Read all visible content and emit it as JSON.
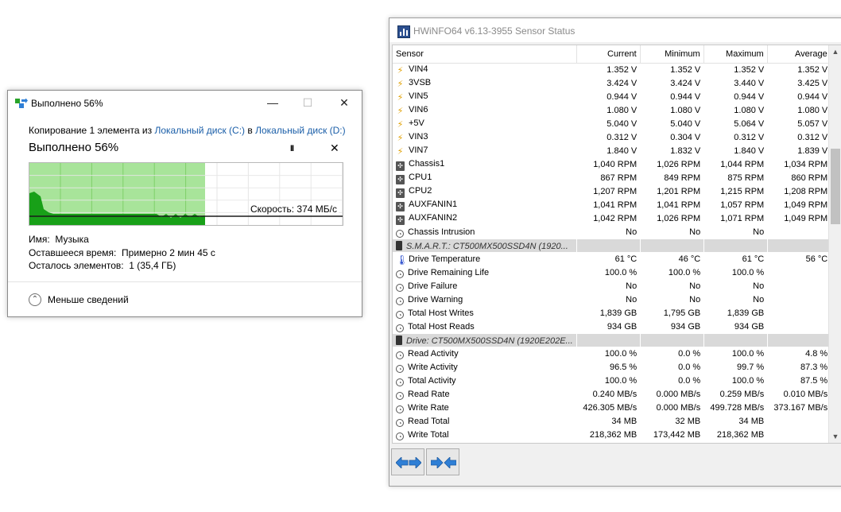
{
  "copy_dialog": {
    "title": "Выполнено 56%",
    "progress_percent": 56,
    "minimize_glyph": "—",
    "maximize_glyph": "☐",
    "close_glyph": "✕",
    "line_prefix": "Копирование 1 элемента из ",
    "source": "Локальный диск (C:)",
    "line_mid": " в ",
    "destination": "Локальный диск (D:)",
    "status": "Выполнено 56%",
    "pause_glyph": "II",
    "cancel_glyph": "✕",
    "speed": "Скорость: 374 МБ/с",
    "name_label": "Имя:",
    "name_value": "Музыка",
    "time_label": "Оставшееся время:",
    "time_value": "Примерно 2 мин 45 с",
    "items_label": "Осталось элементов:",
    "items_value": "1 (35,4 ГБ)",
    "less_details": "Меньше сведений",
    "colors": {
      "fill": "#a8e49a",
      "fill_border": "#7fcf6a",
      "speed_line": "#1b1b1b",
      "graph_fill": "#18a018",
      "link": "#1a5ea8"
    },
    "icon": "copy-files-icon"
  },
  "hwinfo": {
    "title": "HWiNFO64 v6.13-3955 Sensor Status",
    "columns": [
      "Sensor",
      "Current",
      "Minimum",
      "Maximum",
      "Average"
    ],
    "rows": [
      {
        "icon": "voltage-icon",
        "name": "VIN4",
        "current": "1.352 V",
        "minimum": "1.352 V",
        "maximum": "1.352 V",
        "average": "1.352 V"
      },
      {
        "icon": "voltage-icon",
        "name": "3VSB",
        "current": "3.424 V",
        "minimum": "3.424 V",
        "maximum": "3.440 V",
        "average": "3.425 V"
      },
      {
        "icon": "voltage-icon",
        "name": "VIN5",
        "current": "0.944 V",
        "minimum": "0.944 V",
        "maximum": "0.944 V",
        "average": "0.944 V"
      },
      {
        "icon": "voltage-icon",
        "name": "VIN6",
        "current": "1.080 V",
        "minimum": "1.080 V",
        "maximum": "1.080 V",
        "average": "1.080 V"
      },
      {
        "icon": "voltage-icon",
        "name": "+5V",
        "current": "5.040 V",
        "minimum": "5.040 V",
        "maximum": "5.064 V",
        "average": "5.057 V"
      },
      {
        "icon": "voltage-icon",
        "name": "VIN3",
        "current": "0.312 V",
        "minimum": "0.304 V",
        "maximum": "0.312 V",
        "average": "0.312 V"
      },
      {
        "icon": "voltage-icon",
        "name": "VIN7",
        "current": "1.840 V",
        "minimum": "1.832 V",
        "maximum": "1.840 V",
        "average": "1.839 V"
      },
      {
        "icon": "fan-icon",
        "name": "Chassis1",
        "current": "1,040 RPM",
        "minimum": "1,026 RPM",
        "maximum": "1,044 RPM",
        "average": "1,034 RPM"
      },
      {
        "icon": "fan-icon",
        "name": "CPU1",
        "current": "867 RPM",
        "minimum": "849 RPM",
        "maximum": "875 RPM",
        "average": "860 RPM"
      },
      {
        "icon": "fan-icon",
        "name": "CPU2",
        "current": "1,207 RPM",
        "minimum": "1,201 RPM",
        "maximum": "1,215 RPM",
        "average": "1,208 RPM"
      },
      {
        "icon": "fan-icon",
        "name": "AUXFANIN1",
        "current": "1,041 RPM",
        "minimum": "1,041 RPM",
        "maximum": "1,057 RPM",
        "average": "1,049 RPM"
      },
      {
        "icon": "fan-icon",
        "name": "AUXFANIN2",
        "current": "1,042 RPM",
        "minimum": "1,026 RPM",
        "maximum": "1,071 RPM",
        "average": "1,049 RPM"
      },
      {
        "icon": "clock-icon",
        "name": "Chassis Intrusion",
        "current": "No",
        "minimum": "No",
        "maximum": "No",
        "average": ""
      },
      {
        "group": true,
        "icon": "drive-icon",
        "name": "S.M.A.R.T.: CT500MX500SSD4N (1920..."
      },
      {
        "icon": "thermometer-icon",
        "name": "Drive Temperature",
        "current": "61 °C",
        "minimum": "46 °C",
        "maximum": "61 °C",
        "average": "56 °C"
      },
      {
        "icon": "clock-icon",
        "name": "Drive Remaining Life",
        "current": "100.0 %",
        "minimum": "100.0 %",
        "maximum": "100.0 %",
        "average": ""
      },
      {
        "icon": "clock-icon",
        "name": "Drive Failure",
        "current": "No",
        "minimum": "No",
        "maximum": "No",
        "average": ""
      },
      {
        "icon": "clock-icon",
        "name": "Drive Warning",
        "current": "No",
        "minimum": "No",
        "maximum": "No",
        "average": ""
      },
      {
        "icon": "clock-icon",
        "name": "Total Host Writes",
        "current": "1,839 GB",
        "minimum": "1,795 GB",
        "maximum": "1,839 GB",
        "average": ""
      },
      {
        "icon": "clock-icon",
        "name": "Total Host Reads",
        "current": "934 GB",
        "minimum": "934 GB",
        "maximum": "934 GB",
        "average": ""
      },
      {
        "group": true,
        "icon": "drive-icon",
        "name": "Drive: CT500MX500SSD4N (1920E202E..."
      },
      {
        "icon": "clock-icon",
        "name": "Read Activity",
        "current": "100.0 %",
        "minimum": "0.0 %",
        "maximum": "100.0 %",
        "average": "4.8 %"
      },
      {
        "icon": "clock-icon",
        "name": "Write Activity",
        "current": "96.5 %",
        "minimum": "0.0 %",
        "maximum": "99.7 %",
        "average": "87.3 %"
      },
      {
        "icon": "clock-icon",
        "name": "Total Activity",
        "current": "100.0 %",
        "minimum": "0.0 %",
        "maximum": "100.0 %",
        "average": "87.5 %"
      },
      {
        "icon": "clock-icon",
        "name": "Read Rate",
        "current": "0.240 MB/s",
        "minimum": "0.000 MB/s",
        "maximum": "0.259 MB/s",
        "average": "0.010 MB/s"
      },
      {
        "icon": "clock-icon",
        "name": "Write Rate",
        "current": "426.305 MB/s",
        "minimum": "0.000 MB/s",
        "maximum": "499.728 MB/s",
        "average": "373.167 MB/s"
      },
      {
        "icon": "clock-icon",
        "name": "Read Total",
        "current": "34 MB",
        "minimum": "32 MB",
        "maximum": "34 MB",
        "average": ""
      },
      {
        "icon": "clock-icon",
        "name": "Write Total",
        "current": "218,362 MB",
        "minimum": "173,442 MB",
        "maximum": "218,362 MB",
        "average": ""
      }
    ],
    "scroll_up_glyph": "▲",
    "scroll_down_glyph": "▼",
    "nav_buttons": [
      "expand-arrows-icon",
      "collapse-arrows-icon"
    ],
    "colors": {
      "group_bg": "#d9d9d9",
      "voltage": "#e0a000",
      "thermometer": "#1a3fc9",
      "nav_arrow": "#2f7fd6"
    }
  }
}
